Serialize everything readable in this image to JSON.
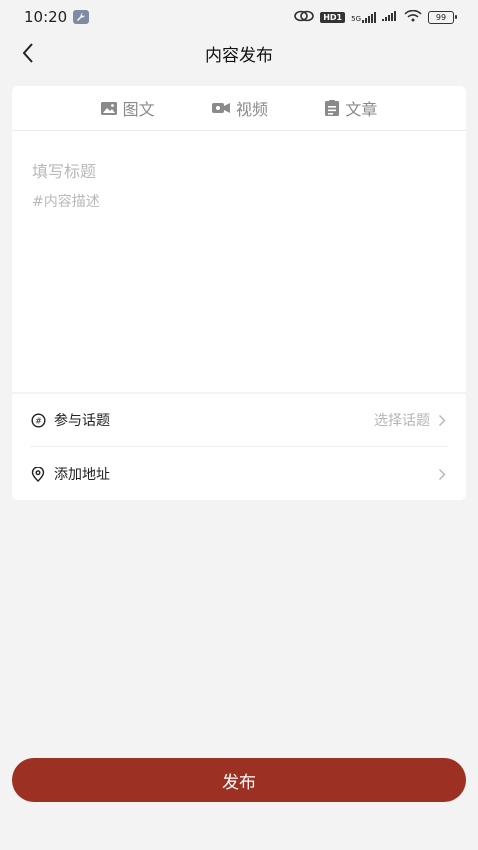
{
  "status_bar": {
    "time": "10:20",
    "network_label": "HD1",
    "signal_label": "5G",
    "battery": "99"
  },
  "header": {
    "title": "内容发布"
  },
  "tabs": [
    {
      "label": "图文",
      "icon": "image-icon"
    },
    {
      "label": "视频",
      "icon": "video-icon"
    },
    {
      "label": "文章",
      "icon": "article-icon"
    }
  ],
  "editor": {
    "title_placeholder": "填写标题",
    "desc_placeholder": "#内容描述"
  },
  "options": {
    "topic_label": "参与话题",
    "topic_value": "选择话题",
    "address_label": "添加地址"
  },
  "footer": {
    "publish_label": "发布"
  },
  "colors": {
    "accent": "#9c3123",
    "background": "#f4f3f4"
  }
}
